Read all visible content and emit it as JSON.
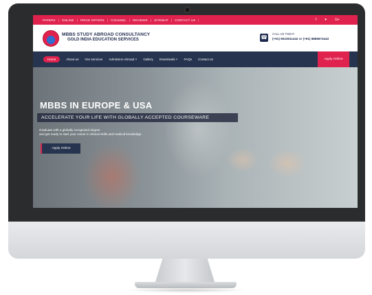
{
  "topbar": {
    "links": [
      "PAPERS",
      "ONLINE",
      "PRICE OFFERS",
      "COUNSEL",
      "REVIEWS",
      "SITEMAP",
      "CONTACT US"
    ],
    "social": [
      "f",
      "♥",
      "G+"
    ]
  },
  "header": {
    "brand_line1": "MBBS STUDY ABROAD CONSULTANCY",
    "brand_line2": "GOLD INDIA EDUCATION SERVICES",
    "call_label": "CALL US TODAY",
    "call_numbers": "(+91) 9023911442 or (+91) 8885874442"
  },
  "nav": {
    "items": [
      "Home",
      "About us",
      "Our services",
      "Admission Abroad ˅",
      "Gallery",
      "Downloads ˅",
      "FAQs",
      "Contact us"
    ],
    "apply_label": "Apply Online"
  },
  "hero": {
    "title": "MBBS IN EUROPE & USA",
    "subtitle": "ACCELERATE YOUR LIFE WITH GLOBALLY ACCEPTED COURSEWARE",
    "desc_line1": "Graduate with a globally recognized degree",
    "desc_line2": "and get ready to start your career in clinical skills and medical knowledge.",
    "apply_label": "Apply Online"
  },
  "colors": {
    "accent": "#e0234e",
    "navy": "#27344f",
    "bezel": "#2b2c2e"
  }
}
